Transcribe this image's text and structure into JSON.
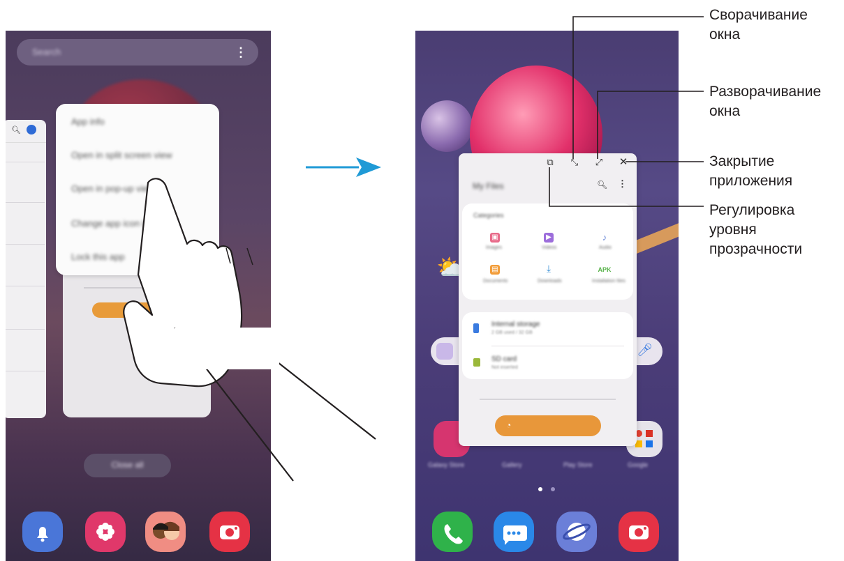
{
  "annotations": {
    "minimize": [
      "Сворачивание",
      "окна"
    ],
    "maximize": [
      "Разворачивание",
      "окна"
    ],
    "close": [
      "Закрытие",
      "приложения"
    ],
    "transparency": [
      "Регулировка",
      "уровня",
      "прозрачности"
    ]
  },
  "left_phone": {
    "search_placeholder": "Search",
    "context_menu": [
      "App info",
      "Open in split screen view",
      "Open in pop-up view",
      "Change app icon badge",
      "Lock this app"
    ],
    "view_all": "Close all"
  },
  "right_phone": {
    "window_title": "My Files",
    "categories_title": "Categories",
    "categories": [
      "Images",
      "Videos",
      "Audio",
      "Documents",
      "Downloads",
      "Installation files"
    ],
    "apk_label": "APK",
    "storage": [
      {
        "name": "Internal storage",
        "detail": "2 GB used / 32 GB"
      },
      {
        "name": "SD card",
        "detail": "Not inserted"
      }
    ],
    "dock_apps": [
      "Galaxy Store",
      "Gallery",
      "Play Store",
      "Google"
    ]
  },
  "colors": {
    "accent_orange": "#e8973a",
    "arrow_blue": "#1f9ad6"
  }
}
